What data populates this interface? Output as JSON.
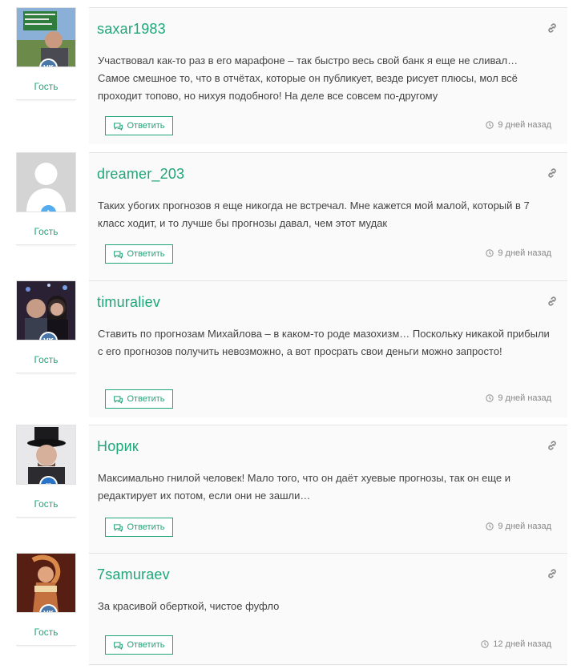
{
  "comments": [
    {
      "author": "saxar1983",
      "role": "Гость",
      "social": "vk",
      "social_icon": "vk-icon",
      "text": "Участвовал как-то раз в его марафоне – так быстро весь свой банк я еще не сливал… Самое смешное то, что в отчётах, которые он публикует, везде рисует плюсы, мол всё проходит топово, но нихуя подобного! На деле все совсем по-другому",
      "reply_label": "Ответить",
      "time": "9 дней назад"
    },
    {
      "author": "dreamer_203",
      "role": "Гость",
      "social": "tw",
      "social_icon": "twitter-icon",
      "text": "Таких убогих прогнозов я еще никогда не встречал. Мне кажется мой малой, который в 7 класс ходит, и то лучше бы прогнозы давал, чем этот мудак",
      "reply_label": "Ответить",
      "time": "9 дней назад"
    },
    {
      "author": "timuraliev",
      "role": "Гость",
      "social": "vk",
      "social_icon": "vk-icon",
      "text": "Ставить по прогнозам Михайлова – в каком-то роде мазохизм… Поскольку никакой прибыли с его прогнозов получить невозможно, а вот просрать свои деньги можно запросто!",
      "reply_label": "Ответить",
      "time": "9 дней назад"
    },
    {
      "author": "Норик",
      "role": "Гость",
      "social": "mail",
      "social_icon": "mail-icon",
      "text": "Максимально гнилой человек! Мало того, что он даёт хуевые прогнозы, так он еще и редактирует их потом, если они не зашли…",
      "reply_label": "Ответить",
      "time": "9 дней назад"
    },
    {
      "author": "7samuraev",
      "role": "Гость",
      "social": "vk",
      "social_icon": "vk-icon",
      "text": "За красивой оберткой, чистое фуфло",
      "reply_label": "Ответить",
      "time": "12 дней назад"
    }
  ],
  "colors": {
    "accent": "#1fa67a",
    "vk": "#4a76a8",
    "twitter": "#55acee",
    "mail": "#2a74c8",
    "card_bg": "#fafafa"
  }
}
